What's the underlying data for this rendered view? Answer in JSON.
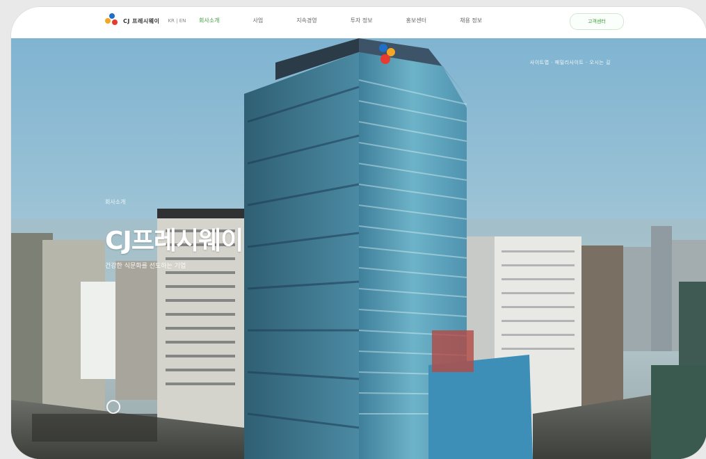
{
  "header": {
    "logo_text": "CJ 프레시웨이",
    "lang": "KR | EN",
    "nav": [
      {
        "label": "회사소개",
        "active": true
      },
      {
        "label": "사업",
        "active": false
      },
      {
        "label": "지속경영",
        "active": false
      },
      {
        "label": "투자 정보",
        "active": false
      },
      {
        "label": "홍보센터",
        "active": false
      },
      {
        "label": "채용 정보",
        "active": false
      }
    ],
    "cta_label": "고객센터"
  },
  "hero": {
    "top_links": "사이트맵 · 패밀리사이트 · 오시는 길",
    "eyebrow": "회사소개",
    "title": "CJ프레시웨이",
    "subtitle": "건강한 식문화를 선도하는 기업"
  },
  "colors": {
    "accent": "#3b9c3b",
    "sky": "#8fbdd6",
    "brand_red": "#e63b2e",
    "brand_orange": "#f5a623",
    "brand_blue": "#1f6fc9"
  }
}
